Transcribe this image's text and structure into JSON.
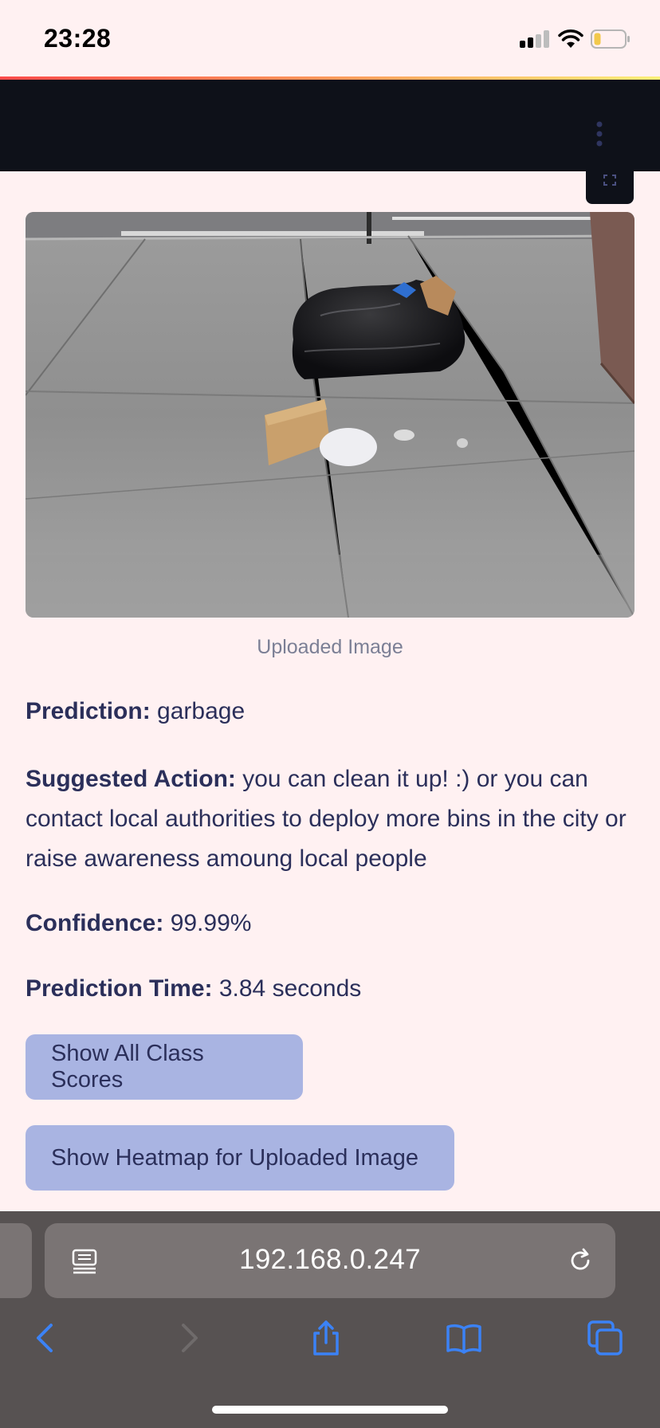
{
  "status_bar": {
    "time": "23:28"
  },
  "colors": {
    "header_bg": "#0e1119",
    "page_bg": "#fff1f2",
    "button_bg": "#a9b4e2",
    "text": "#2b2f5a",
    "browser_bg": "#575252",
    "browser_accent": "#3b82f6"
  },
  "image": {
    "caption": "Uploaded Image"
  },
  "result": {
    "prediction_label": "Prediction:",
    "prediction_value": "garbage",
    "action_label": "Suggested Action:",
    "action_value": "you can clean it up! :) or you can contact local authorities to deploy more bins in the city or raise awareness amoung local people",
    "confidence_label": "Confidence:",
    "confidence_value": "99.99%",
    "time_label": "Prediction Time:",
    "time_value": "3.84 seconds"
  },
  "buttons": {
    "class_scores": "Show All Class Scores",
    "heatmap": "Show Heatmap for Uploaded Image"
  },
  "browser": {
    "url": "192.168.0.247",
    "icons": [
      "reader-icon",
      "reload-icon",
      "back-icon",
      "forward-icon",
      "share-icon",
      "bookmarks-icon",
      "tabs-icon"
    ]
  }
}
